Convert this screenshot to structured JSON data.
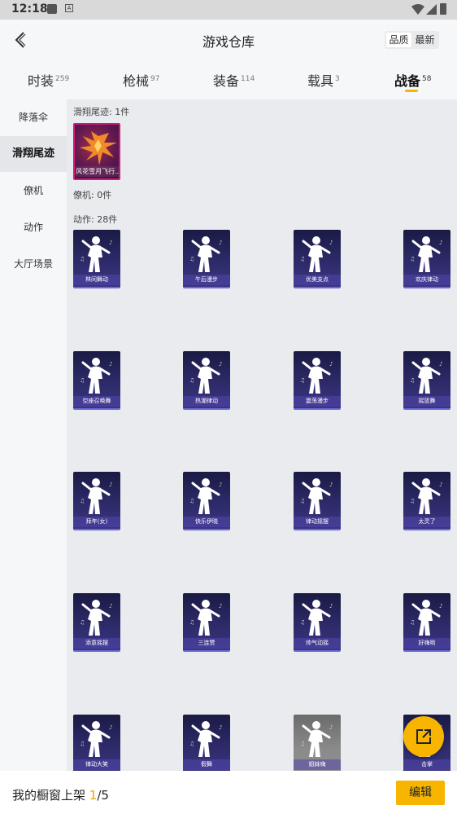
{
  "statusbar": {
    "time": "12:18"
  },
  "header": {
    "title": "游戏仓库",
    "sort": [
      "品质",
      "最新"
    ]
  },
  "tabs": [
    {
      "label": "时装",
      "count": "259"
    },
    {
      "label": "枪械",
      "count": "97"
    },
    {
      "label": "装备",
      "count": "114"
    },
    {
      "label": "载具",
      "count": "3"
    },
    {
      "label": "战备",
      "count": "58"
    }
  ],
  "sidebar": {
    "items": [
      "降落伞",
      "滑翔尾迹",
      "僚机",
      "动作",
      "大厅场景"
    ]
  },
  "sections": {
    "trail": "滑翔尾迹: 1件",
    "wingman": "僚机: 0件",
    "emote": "动作: 28件"
  },
  "trail_items": [
    "风花雪月飞行..."
  ],
  "emotes": [
    "林间舞动",
    "午后漫步",
    "优美支点",
    "欢庆律动",
    "空座召唤舞",
    "热潮律动",
    "震荡漫步",
    "摇篮舞",
    "拜年(女)",
    "快乐伊晓",
    "律动摇摆",
    "太灵了",
    "添意摇摆",
    "三连赞",
    "帅气动摇",
    "好嗨哟",
    "律动大笑",
    "假舞",
    "姐妹嗨",
    "击掌"
  ],
  "bottom": {
    "prefix": "我的橱窗上架 ",
    "current": "1",
    "total": "/5",
    "edit": "编辑"
  }
}
